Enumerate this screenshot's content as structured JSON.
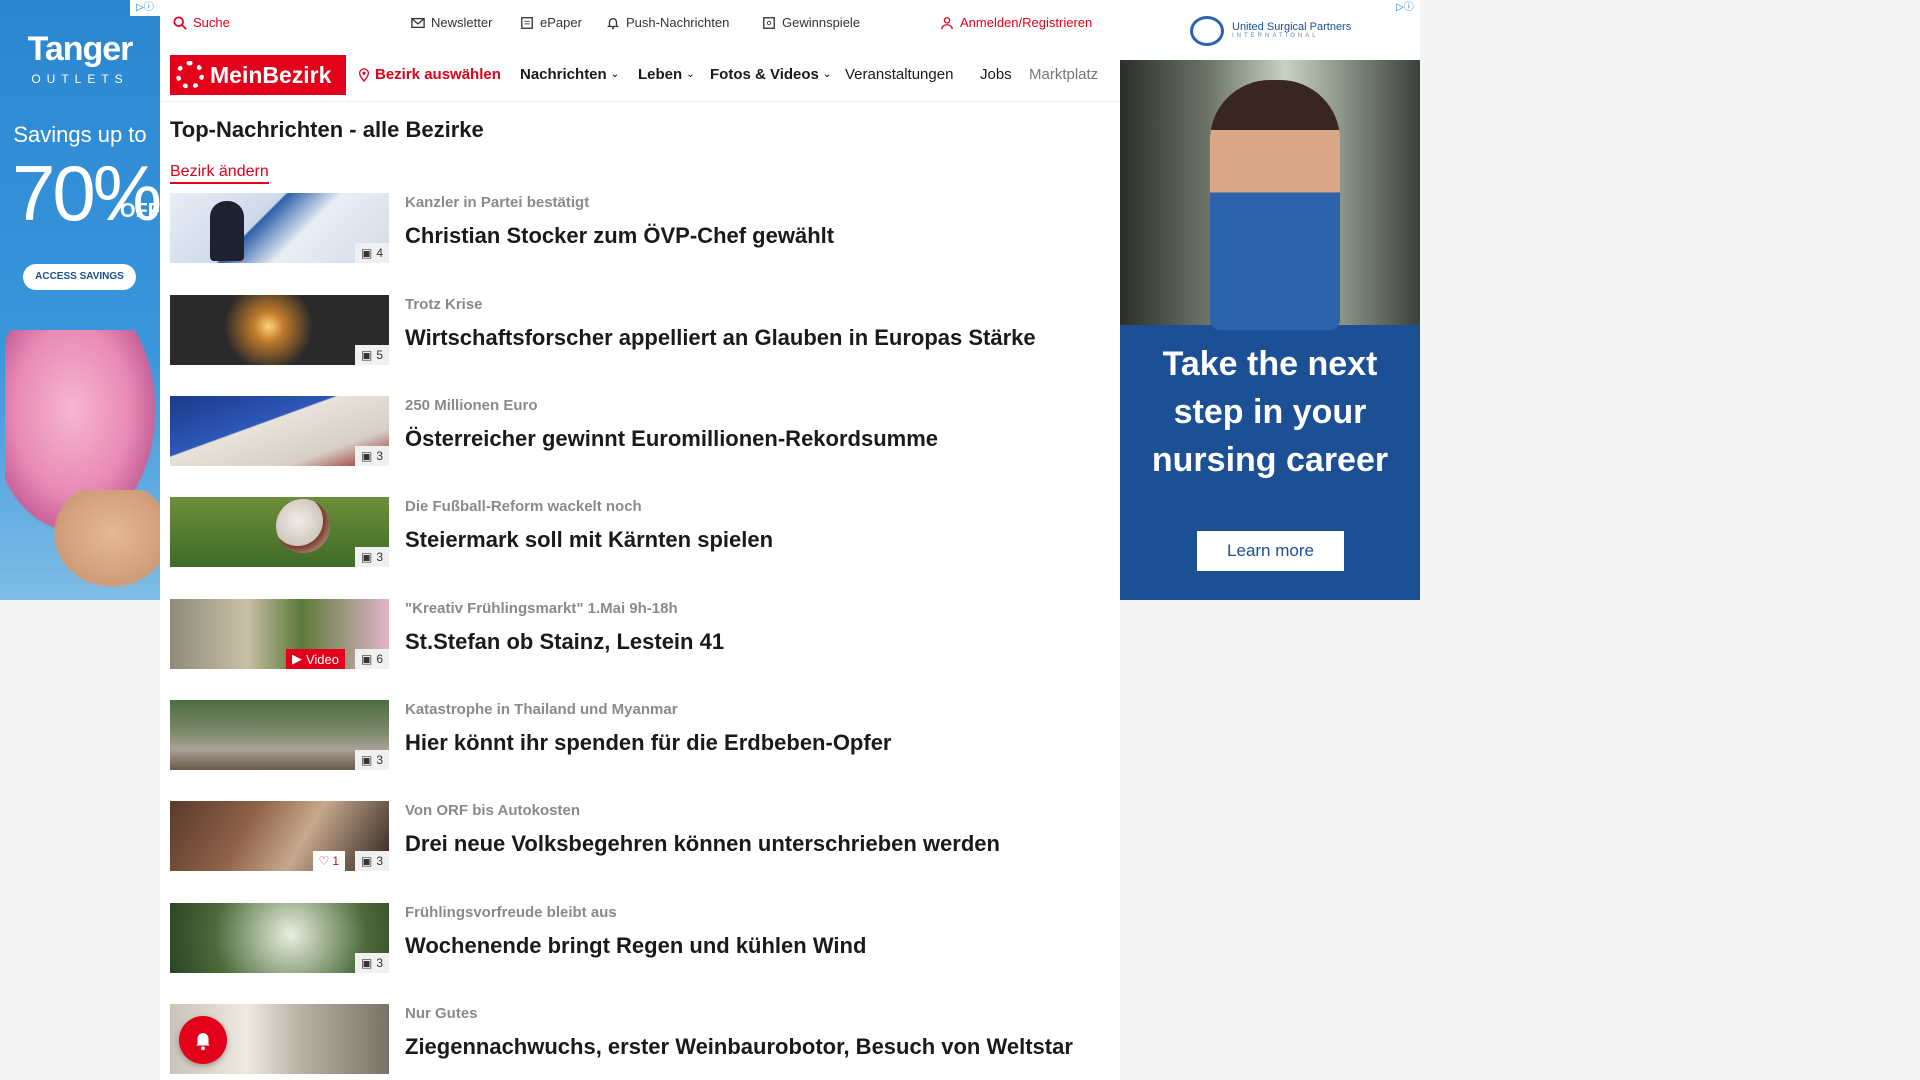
{
  "left_ad": {
    "adchoice": "▷ⓘ",
    "brand": "Tanger",
    "brand_sub": "OUTLETS",
    "savings_line": "Savings up to",
    "savings_value": "70%",
    "savings_off": "OFF",
    "cta": "ACCESS SAVINGS"
  },
  "right_ad": {
    "adchoice": "▷ⓘ",
    "logo_text": "United Surgical Partners",
    "logo_sub": "INTERNATIONAL",
    "headline_1": "Take the next",
    "headline_2": "step in your",
    "headline_3": "nursing career",
    "cta": "Learn more"
  },
  "topbar": {
    "search": "Suche",
    "newsletter": "Newsletter",
    "epaper": "ePaper",
    "push": "Push-Nachrichten",
    "games": "Gewinnspiele",
    "login": "Anmelden/Registrieren"
  },
  "navbar": {
    "logo": "MeinBezirk",
    "district": "Bezirk auswählen",
    "news": "Nachrichten",
    "life": "Leben",
    "photos": "Fotos & Videos",
    "events": "Veranstaltungen",
    "jobs": "Jobs",
    "market": "Marktplatz"
  },
  "section": {
    "title": "Top-Nachrichten - alle Bezirke",
    "change_link": "Bezirk ändern"
  },
  "articles": [
    {
      "kicker": "Kanzler in Partei bestätigt",
      "headline": "Christian Stocker zum ÖVP-Chef gewählt",
      "photos": "4"
    },
    {
      "kicker": "Trotz Krise",
      "headline": "Wirtschaftsforscher appelliert an Glauben in Europas Stärke",
      "photos": "5"
    },
    {
      "kicker": "250 Millionen Euro",
      "headline": "Österreicher gewinnt Euromillionen-Rekordsumme",
      "photos": "3"
    },
    {
      "kicker": "Die Fußball-Reform wackelt noch",
      "headline": "Steiermark soll mit Kärnten spielen",
      "photos": "3"
    },
    {
      "kicker": "\"Kreativ Frühlingsmarkt\" 1.Mai 9h-18h",
      "headline": "St.Stefan ob Stainz, Lestein 41",
      "photos": "6",
      "video": "Video"
    },
    {
      "kicker": "Katastrophe in Thailand und Myanmar",
      "headline": "Hier könnt ihr spenden für die Erdbeben-Opfer",
      "photos": "3"
    },
    {
      "kicker": "Von ORF bis Autokosten",
      "headline": "Drei neue Volksbegehren können unterschrieben werden",
      "photos": "3",
      "likes": "1"
    },
    {
      "kicker": "Frühlingsvorfreude bleibt aus",
      "headline": "Wochenende bringt Regen und kühlen Wind",
      "photos": "3"
    },
    {
      "kicker": "Nur Gutes",
      "headline": "Ziegennachwuchs, erster Weinbaurobotor, Besuch von Weltstar"
    }
  ],
  "colors": {
    "brand": "#e2001a",
    "left_ad_bg": "#2a86cf",
    "right_ad_bg": "#1d4f95"
  }
}
